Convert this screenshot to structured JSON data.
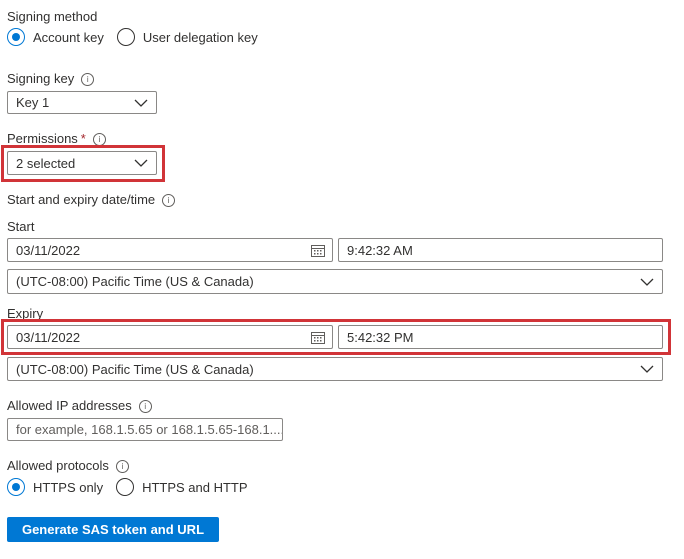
{
  "signing_method": {
    "label": "Signing method",
    "options": [
      {
        "label": "Account key",
        "checked": true
      },
      {
        "label": "User delegation key",
        "checked": false
      }
    ]
  },
  "signing_key": {
    "label": "Signing key",
    "value": "Key 1"
  },
  "permissions": {
    "label": "Permissions",
    "required_mark": "*",
    "value": "2 selected"
  },
  "start_expiry": {
    "label": "Start and expiry date/time",
    "start_label": "Start",
    "start_date": "03/11/2022",
    "start_time": "9:42:32 AM",
    "start_timezone": "(UTC-08:00) Pacific Time (US & Canada)",
    "expiry_label": "Expiry",
    "expiry_date": "03/11/2022",
    "expiry_time": "5:42:32 PM",
    "expiry_timezone": "(UTC-08:00) Pacific Time (US & Canada)"
  },
  "allowed_ip": {
    "label": "Allowed IP addresses",
    "placeholder": "for example, 168.1.5.65 or 168.1.5.65-168.1...."
  },
  "allowed_protocols": {
    "label": "Allowed protocols",
    "options": [
      {
        "label": "HTTPS only",
        "checked": true
      },
      {
        "label": "HTTPS and HTTP",
        "checked": false
      }
    ]
  },
  "generate_button": {
    "label": "Generate SAS token and URL"
  },
  "colors": {
    "accent": "#0078d4",
    "highlight": "#d13438",
    "required": "#a4262c"
  },
  "info_glyph": "i"
}
